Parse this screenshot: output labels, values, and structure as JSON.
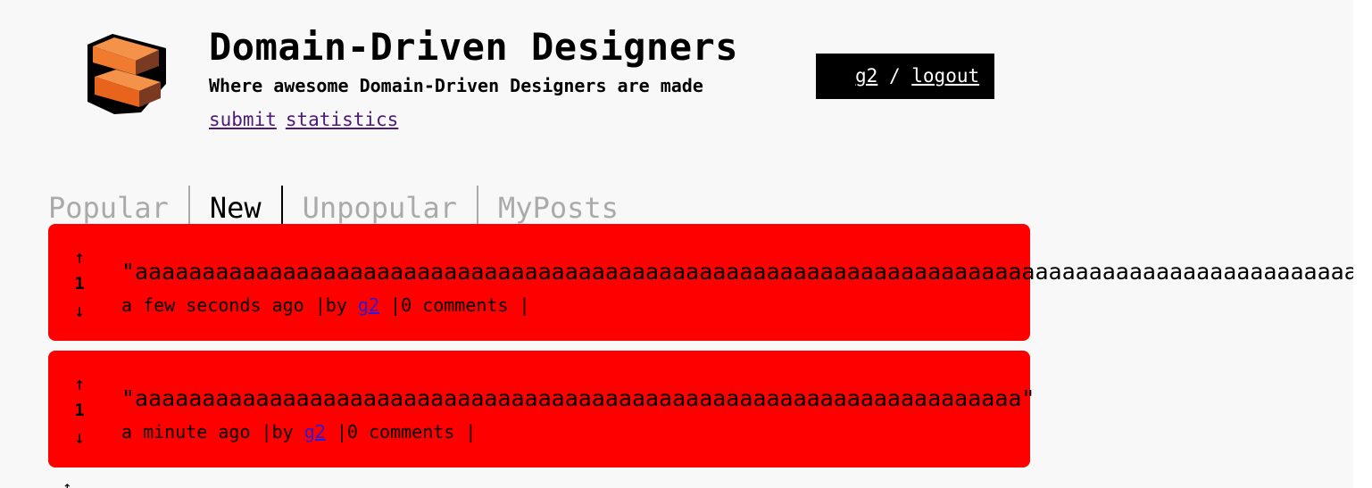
{
  "header": {
    "title": "Domain-Driven Designers",
    "subtitle": "Where awesome Domain-Driven Designers are made",
    "nav": [
      "submit",
      "statistics"
    ],
    "user": "g2",
    "separator": "/",
    "logout": "logout"
  },
  "tabs": [
    "Popular",
    "New",
    "Unpopular",
    "MyPosts"
  ],
  "active_tab": "New",
  "posts": [
    {
      "up": "↑",
      "score": "1",
      "down": "↓",
      "title": "\"aaaaaaaaaaaaaaaaaaaaaaaaaaaaaaaaaaaaaaaaaaaaaaaaaaaaaaaaaaaaaaaaaaaaaaaaaaaaaaaaaaaaaaaaaaaaaaaaaaaaaaaaaaaaaaaaa",
      "time": "a few seconds ago",
      "by_prefix": "|by",
      "author": "g2",
      "comments": "|0 comments |"
    },
    {
      "up": "↑",
      "score": "1",
      "down": "↓",
      "title": "\"aaaaaaaaaaaaaaaaaaaaaaaaaaaaaaaaaaaaaaaaaaaaaaaaaaaaaaaaaaaaaaaaaa\"",
      "time": "a minute ago",
      "by_prefix": "|by",
      "author": "g2",
      "comments": "|0 comments |"
    }
  ],
  "next_up_arrow": "↑",
  "colors": {
    "background": "#f8f8f8",
    "post_background": "#ff0000",
    "user_box": "#000000",
    "inactive_tab": "#aaaaaa",
    "nav_link": "#4b1a7a",
    "author_link": "#2e1bd6",
    "logo_orange": "#f07a2e",
    "logo_brown": "#7a3a22"
  }
}
